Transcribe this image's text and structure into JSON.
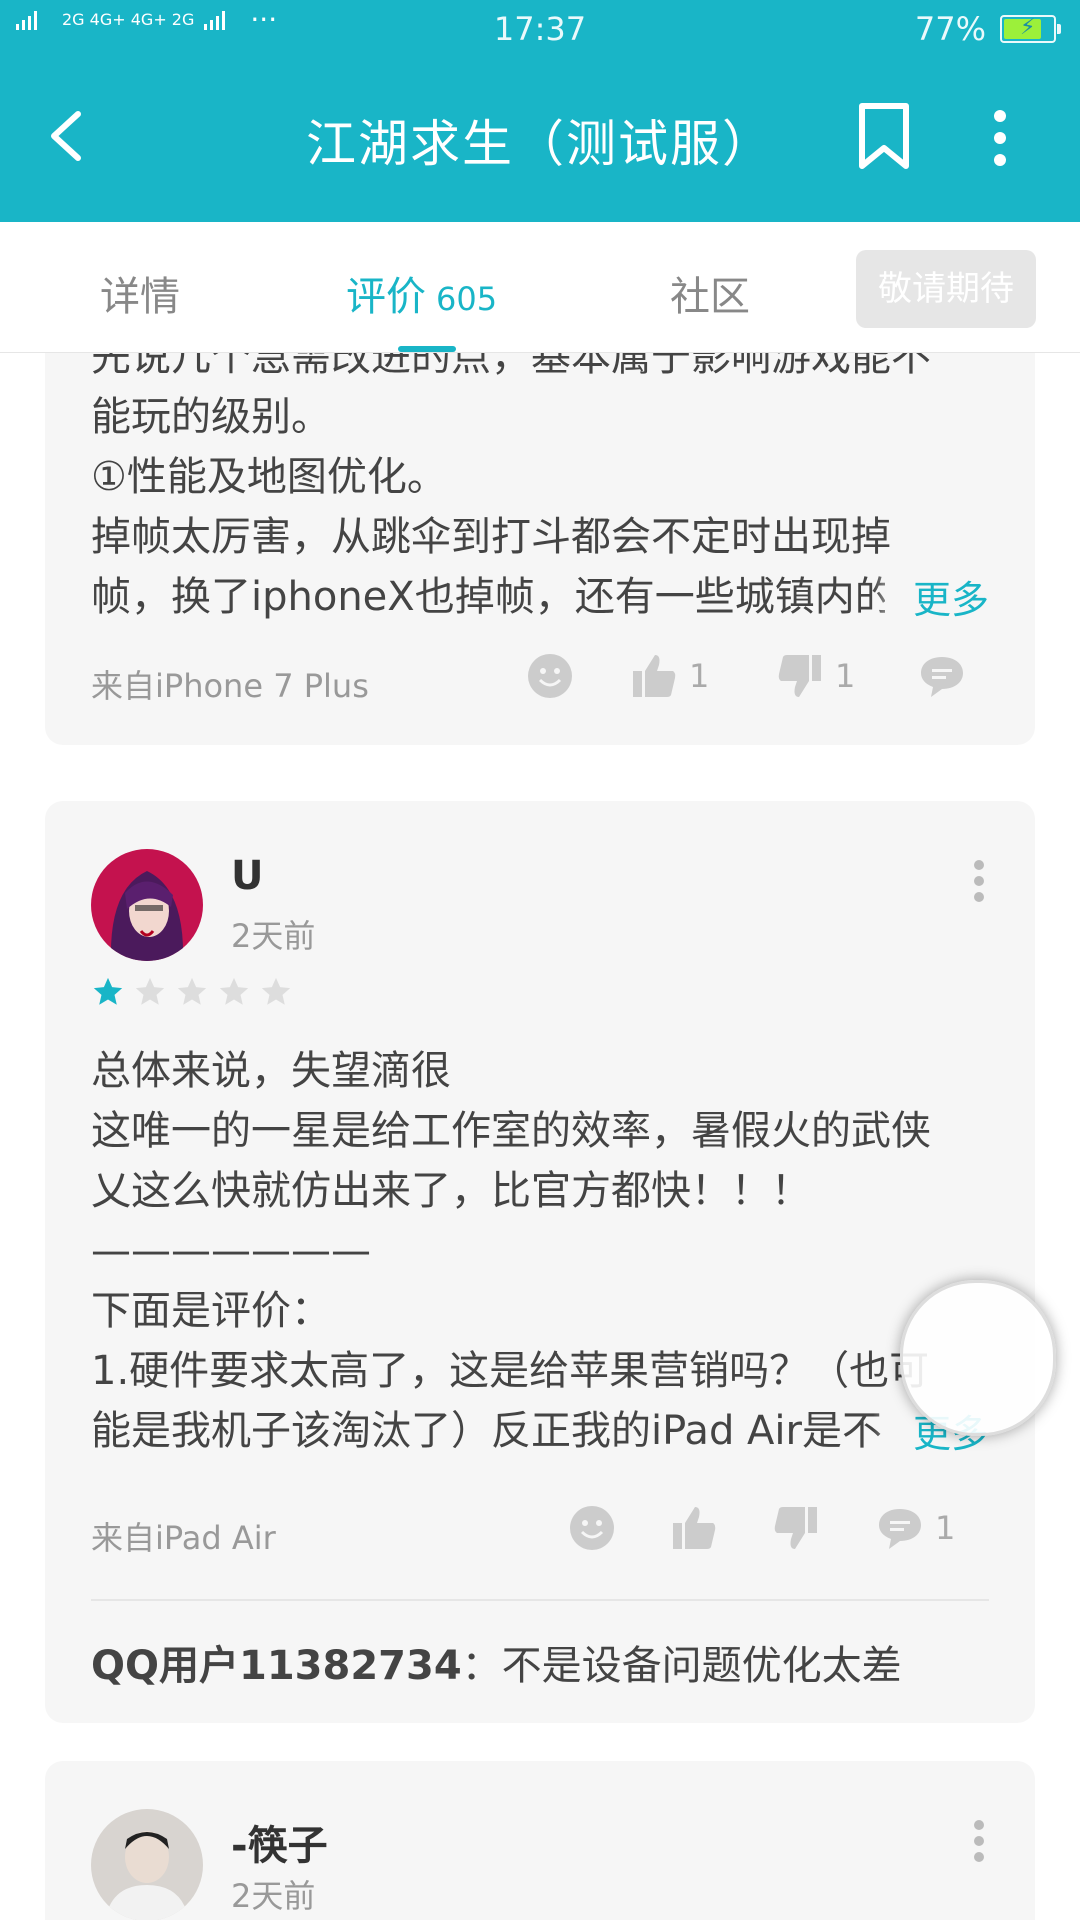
{
  "status_bar": {
    "network": "2G 4G+ 4G+ 2G",
    "dots": "···",
    "time": "17:37",
    "battery": "77%",
    "battery_level": 0.77
  },
  "app_bar": {
    "title": "江湖求生（测试服）",
    "back_icon": "chevron-left-icon",
    "bookmark_icon": "bookmark-icon",
    "more_icon": "more-vertical-icon"
  },
  "tabs": {
    "details": "详情",
    "reviews": "评价",
    "reviews_count": "605",
    "community": "社区",
    "cta": "敬请期待"
  },
  "review1": {
    "lines": [
      "先说几个急需改进的点，基本属于影响游戏能不",
      "能玩的级别。",
      "①性能及地图优化。",
      "掉帧太厉害，从跳伞到打斗都会不定时出现掉",
      "帧，换了iphoneX也掉帧，还有一些城镇内的"
    ],
    "more": "更多",
    "source": "来自iPhone 7 Plus",
    "likes": "1",
    "dislikes": "1"
  },
  "review2": {
    "username": "U",
    "time": "2天前",
    "rating": 1,
    "lines": [
      "总体来说，失望滴很",
      "这唯一的一星是给工作室的效率，暑假火的武侠",
      "乂这么快就仿出来了，比官方都快！！！",
      "———————",
      "下面是评价：",
      "1.硬件要求太高了，这是给苹果营销吗？（也可",
      "能是我机子该淘汰了）反正我的iPad Air是不"
    ],
    "more": "更多",
    "source": "来自iPad Air",
    "comments": "1",
    "reply_user": "QQ用户11382734",
    "reply_text": "：不是设备问题优化太差"
  },
  "review3": {
    "username": "-筷子",
    "time": "2天前"
  },
  "colors": {
    "accent": "#19b5c7",
    "card_bg": "#f6f6f6"
  }
}
